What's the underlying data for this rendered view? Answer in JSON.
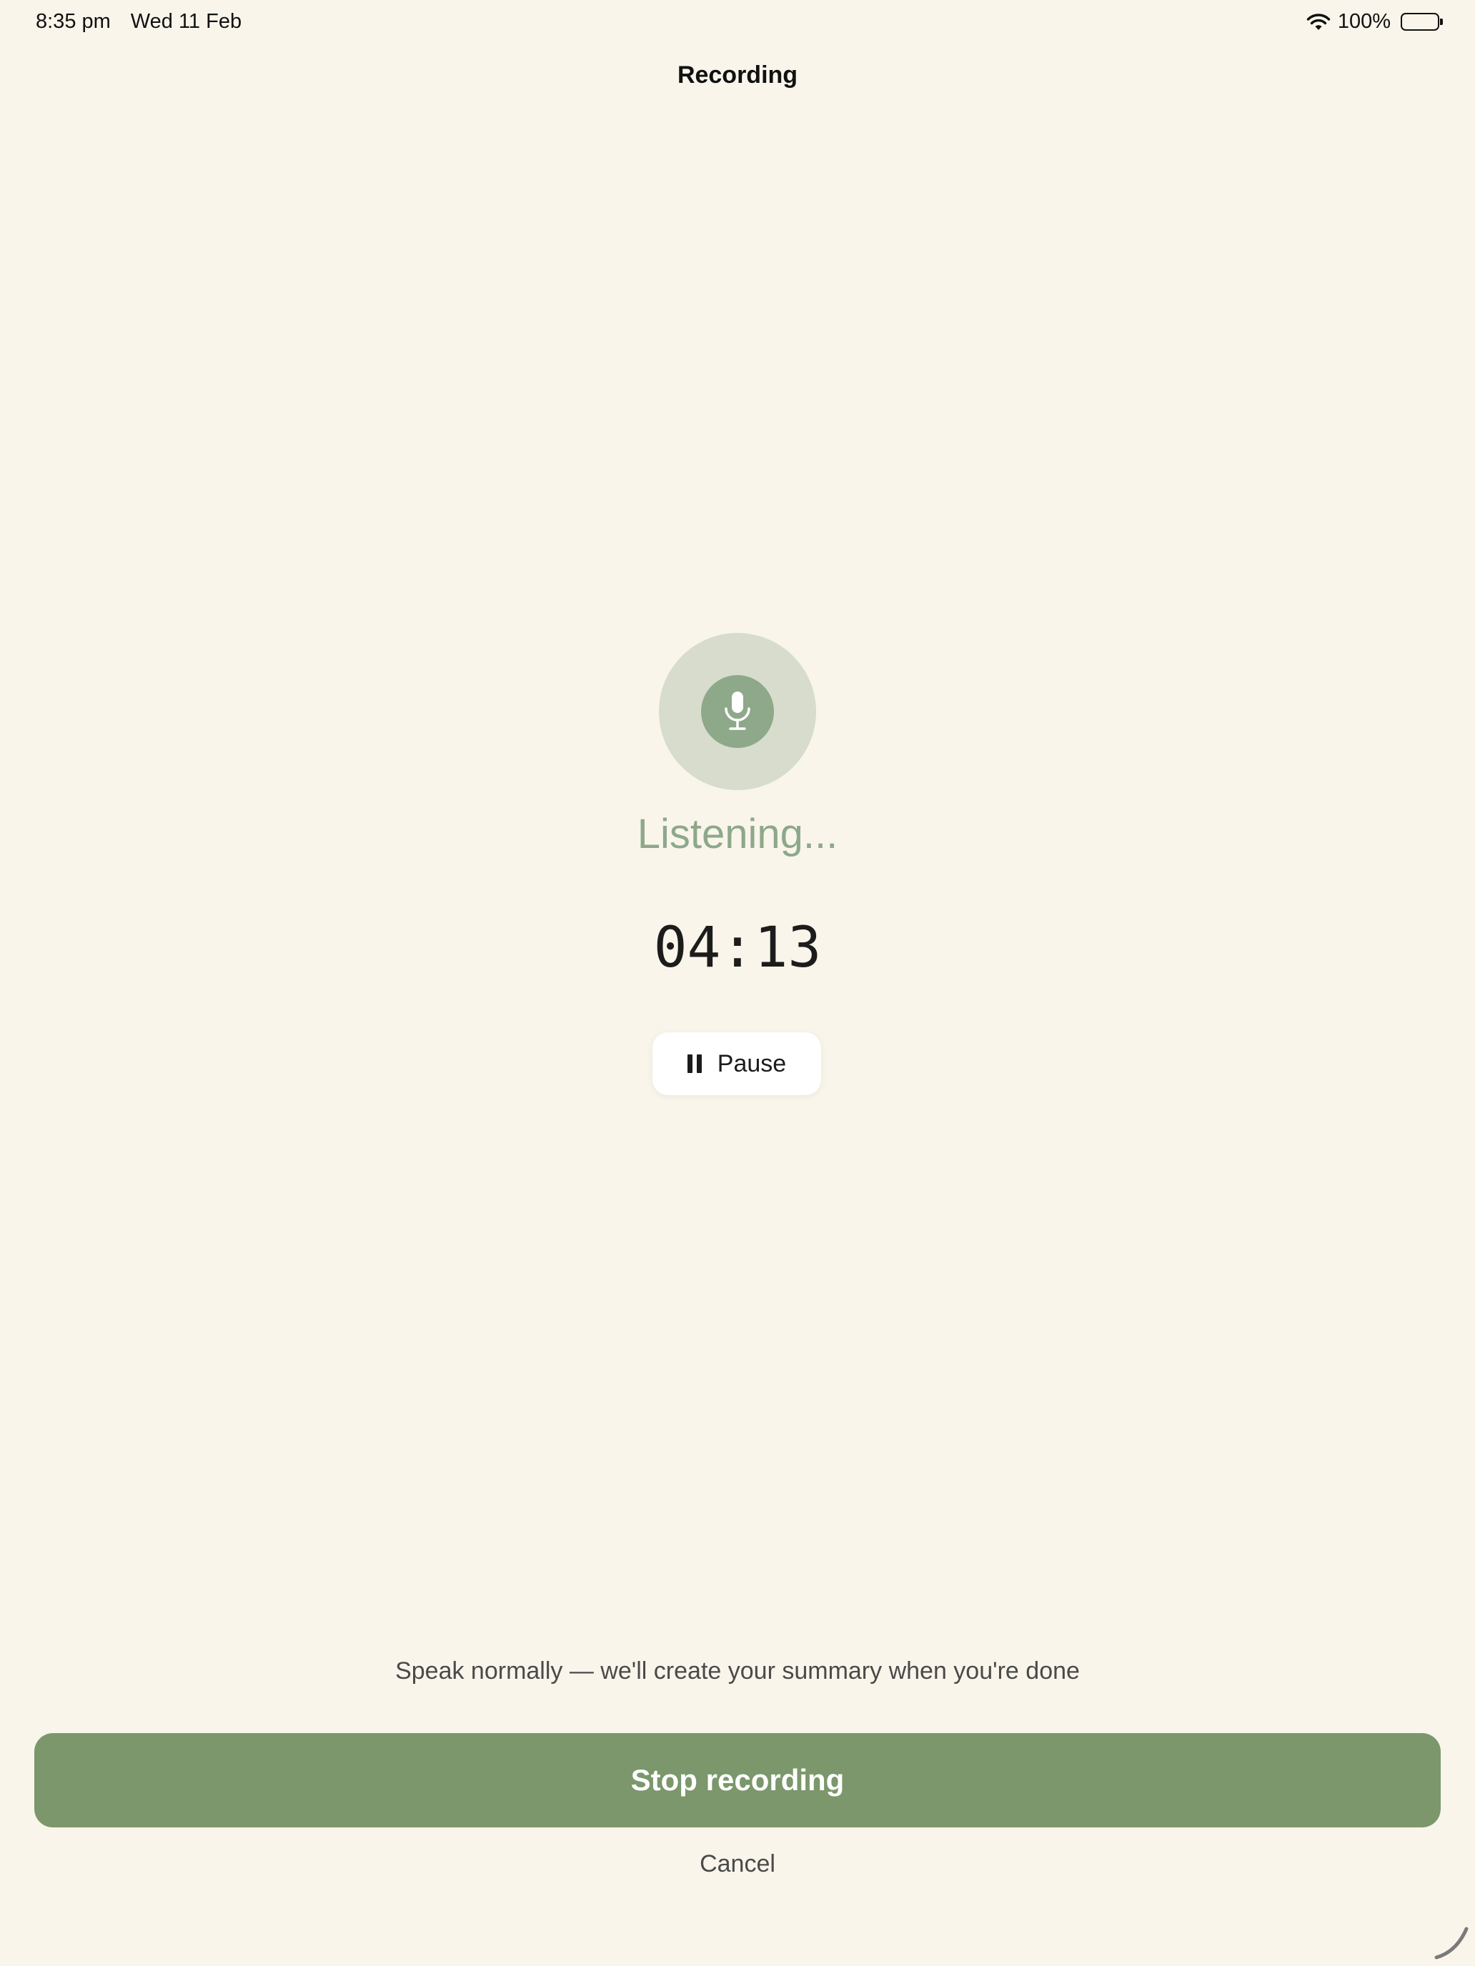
{
  "status_bar": {
    "time": "8:35 pm",
    "date": "Wed 11 Feb",
    "battery": "100%",
    "icons": [
      "wifi-icon",
      "battery-icon"
    ]
  },
  "nav": {
    "title": "Recording"
  },
  "recorder": {
    "icon": "microphone-icon",
    "status": "Listening...",
    "timer": "04:13",
    "pause_label": "Pause",
    "pause_icon": "pause-icon"
  },
  "footer": {
    "hint": "Speak normally — we'll create your summary when you're done",
    "stop_label": "Stop recording",
    "cancel_label": "Cancel"
  },
  "colors": {
    "background": "#f9f5ea",
    "accent": "#7b976b",
    "mic_outer": "#d7dccd",
    "mic_inner": "#8ea88a",
    "listening_text": "#8da88a"
  }
}
